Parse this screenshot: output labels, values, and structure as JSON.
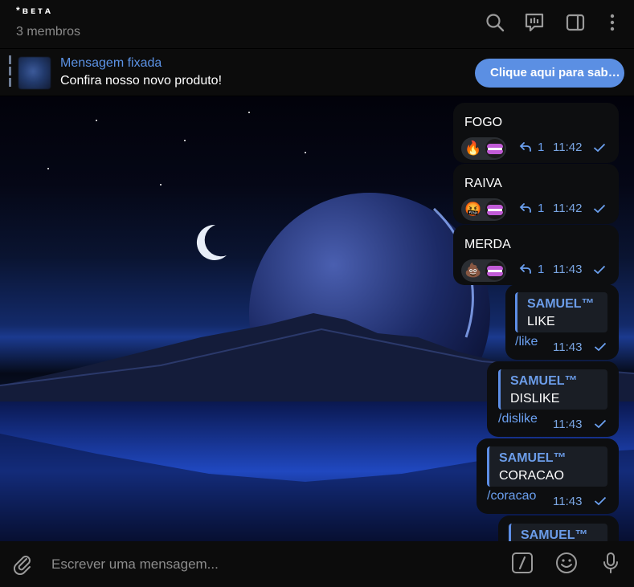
{
  "header": {
    "title": "*ʙᴇᴛᴀ",
    "subtitle": "3 membros",
    "icons": [
      "search-icon",
      "topics-icon",
      "sidebar-toggle-icon",
      "more-icon"
    ]
  },
  "pinned": {
    "title": "Mensagem fixada",
    "text": "Confira nosso novo produto!",
    "button_label": "Clique aqui para saber mais"
  },
  "messages": [
    {
      "text": "FOGO",
      "reactions": [
        "🔥",
        "👄"
      ],
      "reply_count": "1",
      "time": "11:42"
    },
    {
      "text": "RAIVA",
      "reactions": [
        "🤬",
        "👄"
      ],
      "reply_count": "1",
      "time": "11:42"
    },
    {
      "text": "MERDA",
      "reactions": [
        "💩",
        "👄"
      ],
      "reply_count": "1",
      "time": "11:43"
    },
    {
      "quote_name": "SAMUEL™",
      "quote_text": "LIKE",
      "text": "/like",
      "time": "11:43"
    },
    {
      "quote_name": "SAMUEL™",
      "quote_text": "DISLIKE",
      "text": "/dislike",
      "time": "11:43"
    },
    {
      "quote_name": "SAMUEL™",
      "quote_text": "CORACAO",
      "text": "/coracao",
      "time": "11:43"
    },
    {
      "quote_name": "SAMUEL™"
    }
  ],
  "input": {
    "placeholder": "Escrever uma mensagem...",
    "icons": [
      "attach-icon",
      "commands-icon",
      "emoji-icon",
      "microphone-icon"
    ]
  },
  "colors": {
    "accent": "#5b8fe3",
    "bubble": "#0d0e10",
    "panel": "#0c0c0c",
    "link": "#6ba0f0"
  }
}
